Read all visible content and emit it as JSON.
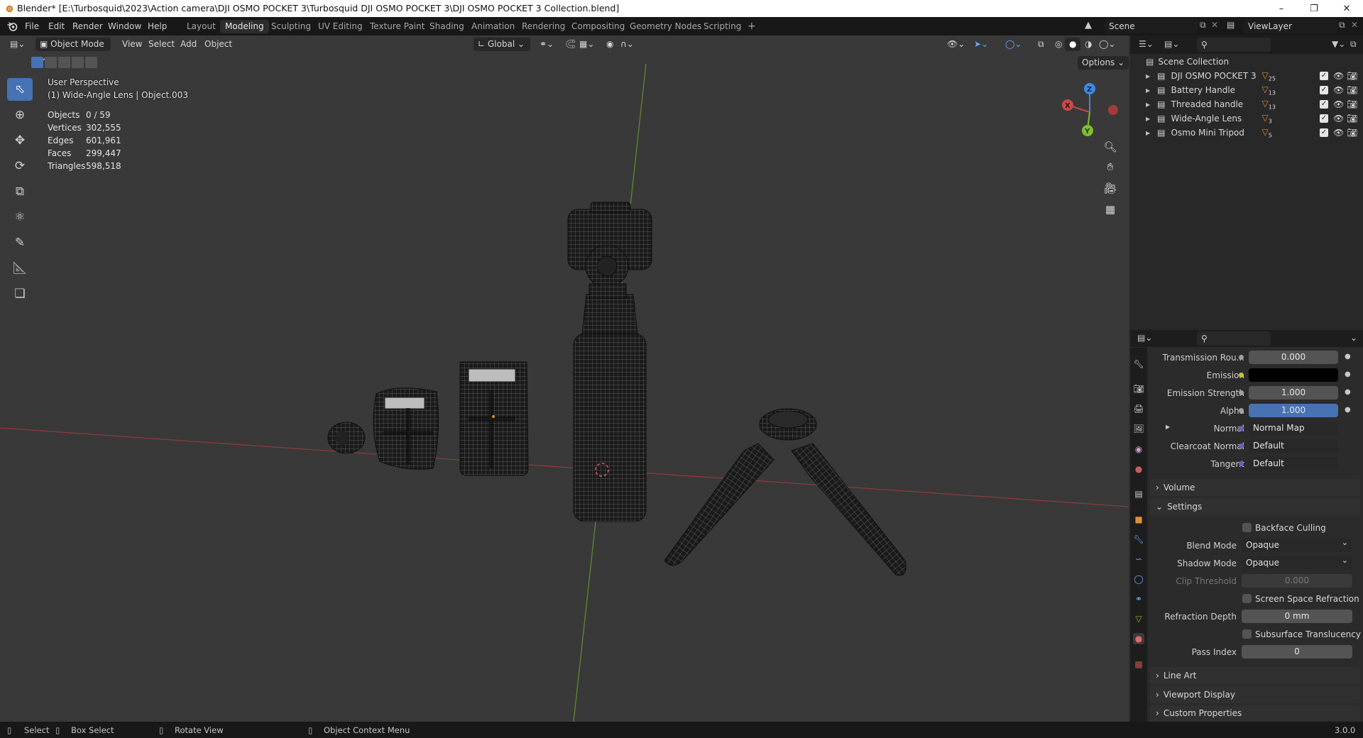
{
  "window": {
    "title": "Blender* [E:\\Turbosquid\\2023\\Action camera\\DJI OSMO POCKET 3\\Turbosquid DJI OSMO POCKET 3\\DJI OSMO POCKET 3 Collection.blend]",
    "minimize": "–",
    "maximize": "❐",
    "close": "✕"
  },
  "menu": [
    "File",
    "Edit",
    "Render",
    "Window",
    "Help"
  ],
  "workspaces": [
    "Layout",
    "Modeling",
    "Sculpting",
    "UV Editing",
    "Texture Paint",
    "Shading",
    "Animation",
    "Rendering",
    "Compositing",
    "Geometry Nodes",
    "Scripting"
  ],
  "active_workspace": "Modeling",
  "add_workspace": "+",
  "scene": {
    "name": "Scene",
    "view_layer": "ViewLayer"
  },
  "viewport_header": {
    "mode": "Object Mode",
    "view": "View",
    "select": "Select",
    "add": "Add",
    "object": "Object",
    "orientation": "Global",
    "options": "Options"
  },
  "overlay": {
    "perspective": "User Perspective",
    "active": "(1) Wide-Angle Lens | Object.003"
  },
  "stats": [
    {
      "label": "Objects",
      "value": "0 / 59"
    },
    {
      "label": "Vertices",
      "value": "302,555"
    },
    {
      "label": "Edges",
      "value": "601,961"
    },
    {
      "label": "Faces",
      "value": "299,447"
    },
    {
      "label": "Triangles",
      "value": "598,518"
    }
  ],
  "gizmo": {
    "x": "X",
    "y": "Y",
    "z": "Z"
  },
  "outliner": {
    "root": "Scene Collection",
    "items": [
      {
        "name": "DJI OSMO POCKET 3",
        "count": "25"
      },
      {
        "name": "Battery Handle",
        "count": "13"
      },
      {
        "name": "Threaded handle",
        "count": "13"
      },
      {
        "name": "Wide-Angle Lens",
        "count": "3"
      },
      {
        "name": "Osmo Mini Tripod",
        "count": "5"
      }
    ]
  },
  "properties": {
    "rows": [
      {
        "label": "Transmission Rou...",
        "value": "0.000"
      },
      {
        "label": "Emission",
        "value": ""
      },
      {
        "label": "Emission Strength",
        "value": "1.000"
      },
      {
        "label": "Alpha",
        "value": "1.000"
      },
      {
        "label": "Normal",
        "value": "Normal Map"
      },
      {
        "label": "Clearcoat Normal",
        "value": "Default"
      },
      {
        "label": "Tangent",
        "value": "Default"
      }
    ],
    "sections": {
      "volume": "Volume",
      "settings": "Settings",
      "line_art": "Line Art",
      "viewport_display": "Viewport Display",
      "custom_properties": "Custom Properties"
    },
    "settings": {
      "backface_culling": "Backface Culling",
      "blend_mode_label": "Blend Mode",
      "blend_mode": "Opaque",
      "shadow_mode_label": "Shadow Mode",
      "shadow_mode": "Opaque",
      "clip_threshold_label": "Clip Threshold",
      "clip_threshold": "0.000",
      "screen_space_refraction": "Screen Space Refraction",
      "refraction_depth_label": "Refraction Depth",
      "refraction_depth": "0 mm",
      "subsurface_translucency": "Subsurface Translucency",
      "pass_index_label": "Pass Index",
      "pass_index": "0"
    }
  },
  "statusbar": {
    "select": "Select",
    "box_select": "Box Select",
    "rotate_view": "Rotate View",
    "context_menu": "Object Context Menu",
    "version": "3.0.0"
  },
  "colors": {
    "accent": "#4772b3",
    "x_axis": "#c74a4a",
    "y_axis": "#7fbf2f",
    "z_axis": "#3d8be0",
    "emission": "#000000"
  }
}
